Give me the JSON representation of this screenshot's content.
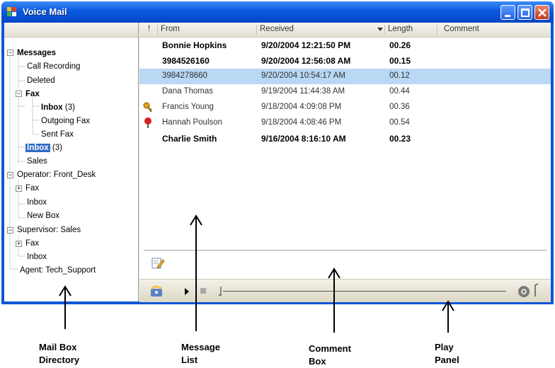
{
  "window": {
    "title": "Voice Mail"
  },
  "tree": {
    "messages": "Messages",
    "call_recording": "Call Recording",
    "deleted": "Deleted",
    "fax": "Fax",
    "fax_inbox": "Inbox",
    "fax_inbox_count": "(3)",
    "outgoing_fax": "Outgoing Fax",
    "sent_fax": "Sent Fax",
    "inbox": "Inbox",
    "inbox_count": "(3)",
    "sales": "Sales",
    "operator": "Operator: Front_Desk",
    "op_fax": "Fax",
    "op_inbox": "Inbox",
    "op_new_box": "New Box",
    "supervisor": "Supervisor: Sales",
    "sup_fax": "Fax",
    "sup_inbox": "Inbox",
    "agent": "Agent: Tech_Support"
  },
  "columns": {
    "flag": "!",
    "from": "From",
    "received": "Received",
    "length": "Length",
    "comment": "Comment"
  },
  "messages": [
    {
      "from": "Bonnie Hopkins",
      "received": "9/20/2004 12:21:50 PM",
      "length": "00.26",
      "style": "bold",
      "icon": ""
    },
    {
      "from": "3984526160",
      "received": "9/20/2004 12:56:08 AM",
      "length": "00.15",
      "style": "bold",
      "icon": ""
    },
    {
      "from": "3984278660",
      "received": "9/20/2004 10:54:17 AM",
      "length": "00.12",
      "style": "selected",
      "icon": ""
    },
    {
      "from": "Dana Thomas",
      "received": "9/19/2004 11:44:38 AM",
      "length": "00.44",
      "style": "normal",
      "icon": ""
    },
    {
      "from": "Francis Young",
      "received": "9/18/2004 4:09:08 PM",
      "length": "00.36",
      "style": "normal",
      "icon": "key-icon"
    },
    {
      "from": "Hannah Poulson",
      "received": "9/18/2004 4:08:46 PM",
      "length": "00.54",
      "style": "normal",
      "icon": "pin-icon"
    },
    {
      "from": "Charlie Smith",
      "received": "9/16/2004 8:16:10 AM",
      "length": "00.23",
      "style": "bold",
      "icon": ""
    }
  ],
  "annotations": {
    "mailbox": "Mail Box\nDirectory",
    "message_list": "Message\nList",
    "comment_box": "Comment\nBox",
    "play_panel": "Play\nPanel"
  },
  "colors": {
    "titlebar": "#0a5ae0",
    "selection": "#316ac5",
    "row_selected": "#b8d8f4"
  }
}
